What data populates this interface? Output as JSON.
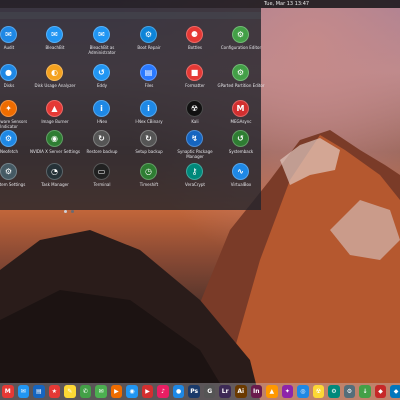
{
  "topbar": {
    "clock": "Tue, Mar 13   13:47"
  },
  "launcher": {
    "apps": [
      {
        "label": "Audit",
        "glyph": "✉",
        "color": "#1e88e5"
      },
      {
        "label": "BleachBit",
        "glyph": "✉",
        "color": "#2196f3"
      },
      {
        "label": "BleachBit as Administrator",
        "glyph": "✉",
        "color": "#2196f3"
      },
      {
        "label": "Boot Repair",
        "glyph": "⚙",
        "color": "#0d84d8"
      },
      {
        "label": "Bottles",
        "glyph": "⚈",
        "color": "#e53935"
      },
      {
        "label": "Configuration Editor",
        "glyph": "⚙",
        "color": "#43a047"
      },
      {
        "label": "Disks",
        "glyph": "●",
        "color": "#1e88e5"
      },
      {
        "label": "Disk Usage Analyzer",
        "glyph": "◐",
        "color": "#f4a21f"
      },
      {
        "label": "Eddy",
        "glyph": "↺",
        "color": "#2196f3"
      },
      {
        "label": "Files",
        "glyph": "▤",
        "color": "#2979ff"
      },
      {
        "label": "Formatter",
        "glyph": "■",
        "color": "#e53935"
      },
      {
        "label": "GParted Partition Editor",
        "glyph": "⚙",
        "color": "#43a047"
      },
      {
        "label": "Hardware Sensors Indicator",
        "glyph": "✦",
        "color": "#ef6c00"
      },
      {
        "label": "Image Burner",
        "glyph": "▲",
        "color": "#e53935"
      },
      {
        "label": "I-Nex",
        "glyph": "i",
        "color": "#1e88e5"
      },
      {
        "label": "I-Nex CBinary",
        "glyph": "i",
        "color": "#1e88e5"
      },
      {
        "label": "Kali",
        "glyph": "☢",
        "color": "#111111"
      },
      {
        "label": "MEGAsync",
        "glyph": "M",
        "color": "#d32f2f"
      },
      {
        "label": "Neofetch",
        "glyph": "⚙",
        "color": "#1e88e5"
      },
      {
        "label": "NVIDIA X Server Settings",
        "glyph": "◉",
        "color": "#2e7d32"
      },
      {
        "label": "Restore backup",
        "glyph": "↻",
        "color": "#555555"
      },
      {
        "label": "Setup backup",
        "glyph": "↻",
        "color": "#555555"
      },
      {
        "label": "Synaptic Package Manager",
        "glyph": "↯",
        "color": "#1565c0"
      },
      {
        "label": "Systemback",
        "glyph": "↺",
        "color": "#2e7d32"
      },
      {
        "label": "System Settings",
        "glyph": "⚙",
        "color": "#455a64"
      },
      {
        "label": "Task Manager",
        "glyph": "◔",
        "color": "#263238"
      },
      {
        "label": "Terminal",
        "glyph": "▭",
        "color": "#212121"
      },
      {
        "label": "Timeshift",
        "glyph": "◷",
        "color": "#2e7d32"
      },
      {
        "label": "VeraCrypt",
        "glyph": "⚷",
        "color": "#00897b"
      },
      {
        "label": "VirtualBox",
        "glyph": "∿",
        "color": "#1e88e5"
      }
    ]
  },
  "dock": {
    "icons": [
      {
        "name": "gmail-icon",
        "glyph": "M",
        "color": "#e53935"
      },
      {
        "name": "mail-icon",
        "glyph": "✉",
        "color": "#2196f3"
      },
      {
        "name": "files-icon",
        "glyph": "▤",
        "color": "#1565c0"
      },
      {
        "name": "store-icon",
        "glyph": "★",
        "color": "#e53935"
      },
      {
        "name": "notes-icon",
        "glyph": "✎",
        "color": "#fdd835"
      },
      {
        "name": "phone-icon",
        "glyph": "✆",
        "color": "#43a047"
      },
      {
        "name": "chat-icon",
        "glyph": "✉",
        "color": "#4caf50"
      },
      {
        "name": "video-icon",
        "glyph": "▶",
        "color": "#ef6c00"
      },
      {
        "name": "browser-icon",
        "glyph": "◉",
        "color": "#2196f3"
      },
      {
        "name": "youtube-icon",
        "glyph": "▶",
        "color": "#d32f2f"
      },
      {
        "name": "music-icon",
        "glyph": "♪",
        "color": "#e91e63"
      },
      {
        "name": "social-icon",
        "glyph": "●",
        "color": "#1e88e5"
      },
      {
        "name": "ps-icon",
        "glyph": "Ps",
        "color": "#1a3a6a"
      },
      {
        "name": "gimp-icon",
        "glyph": "G",
        "color": "#555555"
      },
      {
        "name": "lightroom-icon",
        "glyph": "Lr",
        "color": "#3d2a55"
      },
      {
        "name": "illustrator-icon",
        "glyph": "Ai",
        "color": "#6b3a00"
      },
      {
        "name": "indesign-icon",
        "glyph": "In",
        "color": "#6a1b4d"
      },
      {
        "name": "vlc-icon",
        "glyph": "▲",
        "color": "#ff9800"
      },
      {
        "name": "gamepad-icon",
        "glyph": "✦",
        "color": "#8e24aa"
      },
      {
        "name": "steam-icon",
        "glyph": "◎",
        "color": "#1e88e5"
      },
      {
        "name": "kali-icon",
        "glyph": "☢",
        "color": "#fdd835"
      },
      {
        "name": "tools-icon",
        "glyph": "⚙",
        "color": "#00897b"
      },
      {
        "name": "settings-icon",
        "glyph": "⚙",
        "color": "#546e7a"
      },
      {
        "name": "torrent-icon",
        "glyph": "↓",
        "color": "#43a047"
      },
      {
        "name": "ruby-icon",
        "glyph": "◆",
        "color": "#c62828"
      },
      {
        "name": "security-icon",
        "glyph": "◆",
        "color": "#0277bd"
      }
    ]
  }
}
